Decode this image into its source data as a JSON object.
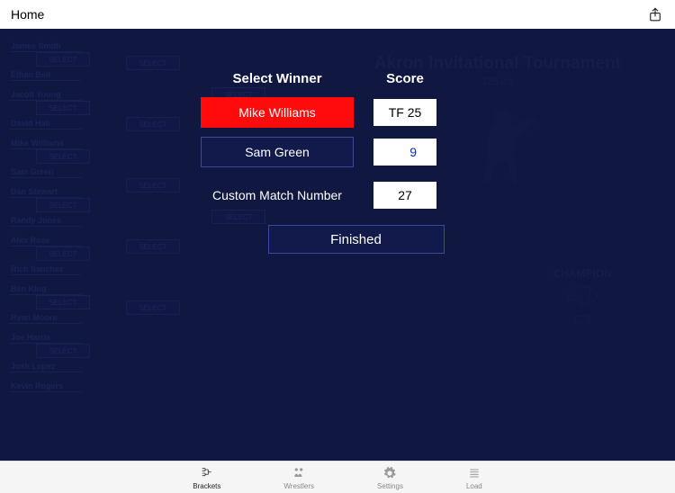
{
  "topbar": {
    "home": "Home"
  },
  "tournament": {
    "title": "Akron Invitational Tournament",
    "weight": "125 lbs",
    "champion_label": "CHAMPION"
  },
  "modal": {
    "select_winner_label": "Select Winner",
    "score_label": "Score",
    "wrestler1": "Mike Williams",
    "wrestler1_score": "TF 25",
    "wrestler2": "Sam Green",
    "wrestler2_score": "9",
    "custom_match_label": "Custom Match Number",
    "custom_match_value": "27",
    "finished": "Finished"
  },
  "tabs": {
    "brackets": "Brackets",
    "wrestlers": "Wrestlers",
    "settings": "Settings",
    "load": "Load"
  },
  "bracket_names": [
    "James Smith",
    "Ethan Bell",
    "Jacob Young",
    "David Hall",
    "Mike Williams",
    "Sam Green",
    "Dan Stewart",
    "Randy Jones",
    "Alex Rose",
    "Rich Sanchez",
    "Ben King",
    "Ryan Moore",
    "Joe Harris",
    "Josh Lopez",
    "Kevin Rogers"
  ],
  "select_label": "SELECT"
}
